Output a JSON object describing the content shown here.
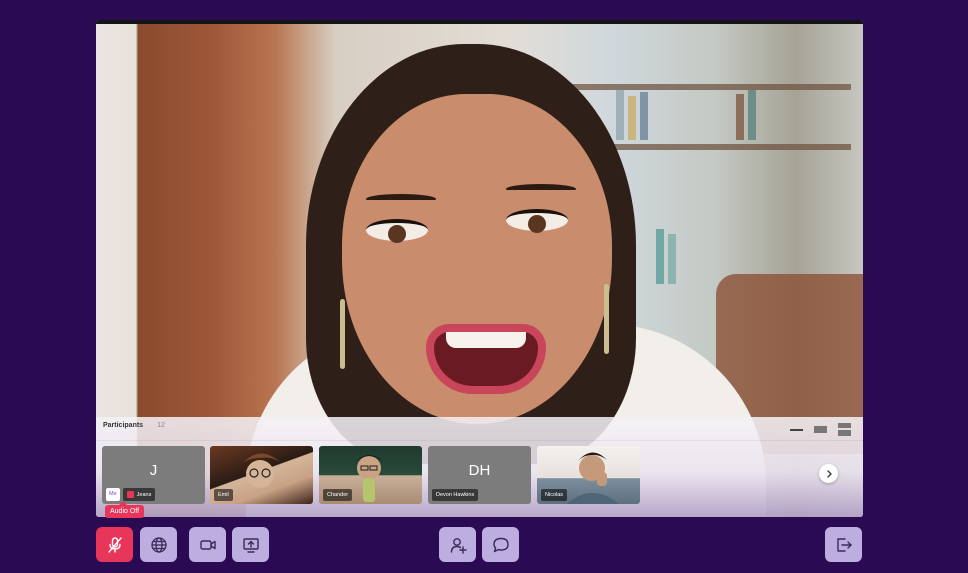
{
  "meeting": {
    "participants_title": "Participants",
    "participants_count": "12",
    "tiles": [
      {
        "initials": "J",
        "me_label": "Me",
        "name": "Jeans"
      },
      {
        "name": "Emil"
      },
      {
        "name": "Chander"
      },
      {
        "initials": "DH",
        "name": "Devon Hawkins"
      },
      {
        "name": "Nicolas"
      }
    ],
    "tooltip": "Audio Off"
  },
  "icons": {
    "mic_off": "mic-off-icon",
    "globe": "globe-icon",
    "video": "video-camera-icon",
    "screen_share": "screen-share-icon",
    "add_user": "add-user-icon",
    "chat": "chat-bubble-icon",
    "leave": "leave-icon",
    "chevron_right": "chevron-right-icon"
  },
  "colors": {
    "background": "#2a0a52",
    "button": "#bcaee0",
    "danger": "#e8365a"
  }
}
